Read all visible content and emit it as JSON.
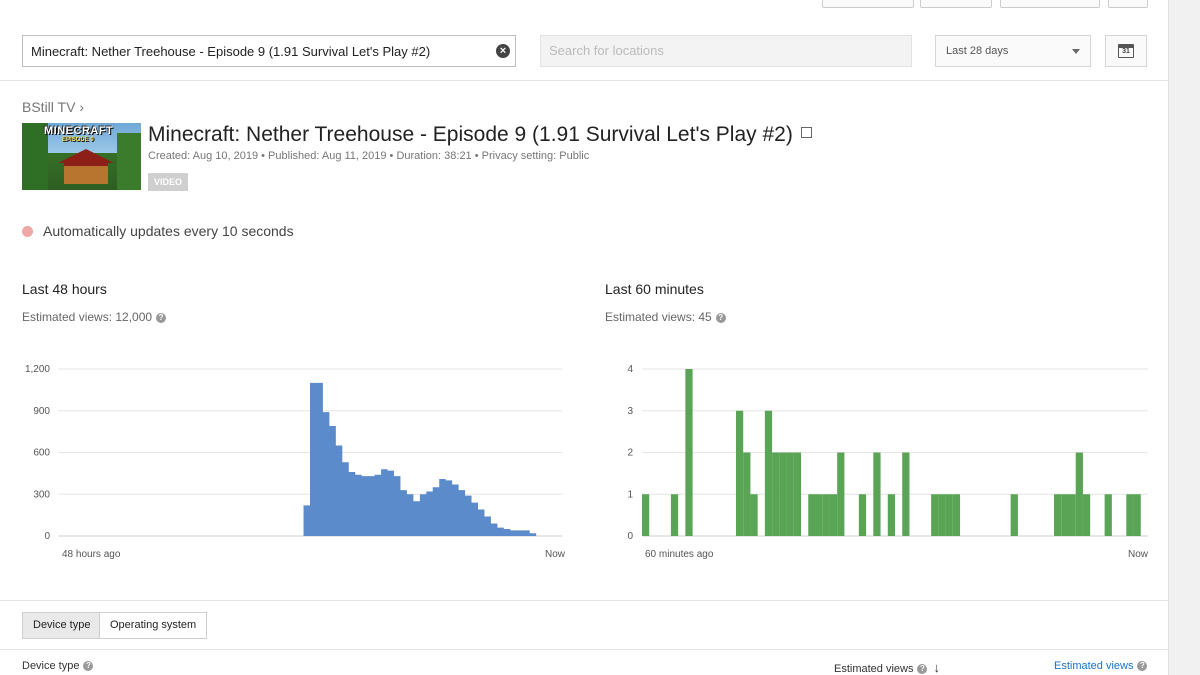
{
  "search": {
    "value": "Minecraft: Nether Treehouse - Episode 9 (1.91 Survival Let's Play #2)",
    "clear_icon": "close-circle-icon"
  },
  "locations": {
    "placeholder": "Search for locations"
  },
  "date_range": {
    "label": "Last 28 days"
  },
  "calendar": {
    "day": "31",
    "icon": "calendar-icon"
  },
  "breadcrumb": {
    "channel": "BStill TV",
    "separator": "›"
  },
  "thumbnail": {
    "logo": "MINECRAFT",
    "subtitle": "EPISODE 9"
  },
  "video": {
    "title": "Minecraft: Nether Treehouse - Episode 9 (1.91 Survival Let's Play #2)",
    "meta": "Created: Aug 10, 2019  •  Published: Aug 11, 2019  •  Duration: 38:21  •  Privacy setting: Public",
    "badge": "VIDEO"
  },
  "auto_update": "Automatically updates every 10 seconds",
  "colors": {
    "bar_blue": "#5b8bcb",
    "bar_green": "#59a455",
    "status_dot": "#f0a7a7"
  },
  "left_panel": {
    "title": "Last 48 hours",
    "estimated": "Estimated views: 12,000",
    "x_start": "48 hours ago",
    "x_end": "Now"
  },
  "right_panel": {
    "title": "Last 60 minutes",
    "estimated": "Estimated views: 45",
    "x_start": "60 minutes ago",
    "x_end": "Now"
  },
  "chart_data": [
    {
      "type": "bar",
      "ylim": [
        0,
        1200
      ],
      "yticks": [
        "0",
        "300",
        "600",
        "900",
        "1,200"
      ],
      "ytick_values": [
        0,
        300,
        600,
        900,
        1200
      ],
      "values": [
        0,
        0,
        0,
        0,
        0,
        0,
        0,
        0,
        0,
        0,
        0,
        0,
        0,
        0,
        0,
        0,
        0,
        0,
        0,
        0,
        0,
        0,
        0,
        0,
        0,
        0,
        0,
        0,
        0,
        0,
        0,
        0,
        0,
        0,
        0,
        0,
        0,
        0,
        220,
        1100,
        1100,
        890,
        790,
        650,
        530,
        460,
        440,
        430,
        430,
        440,
        480,
        470,
        430,
        330,
        300,
        250,
        300,
        320,
        350,
        410,
        400,
        370,
        330,
        290,
        240,
        190,
        140,
        90,
        60,
        50,
        40,
        40,
        40,
        20,
        0,
        0,
        0,
        0
      ]
    },
    {
      "type": "bar",
      "ylim": [
        0,
        4
      ],
      "yticks": [
        "0",
        "1",
        "2",
        "3",
        "4"
      ],
      "ytick_values": [
        0,
        1,
        2,
        3,
        4
      ],
      "values": [
        1,
        0,
        0,
        0,
        1,
        0,
        4,
        0,
        0,
        0,
        0,
        0,
        0,
        3,
        2,
        1,
        0,
        3,
        2,
        2,
        2,
        2,
        0,
        1,
        1,
        1,
        1,
        2,
        0,
        0,
        1,
        0,
        2,
        0,
        1,
        0,
        2,
        0,
        0,
        0,
        1,
        1,
        1,
        1,
        0,
        0,
        0,
        0,
        0,
        0,
        0,
        1,
        0,
        0,
        0,
        0,
        0,
        1,
        1,
        1,
        2,
        1,
        0,
        0,
        1,
        0,
        0,
        1,
        1,
        0
      ]
    }
  ],
  "tabs": {
    "device_type": "Device type",
    "operating_system": "Operating system"
  },
  "table_header": {
    "first_col": "Device type",
    "col2": "Estimated views",
    "col3": "Estimated views"
  }
}
